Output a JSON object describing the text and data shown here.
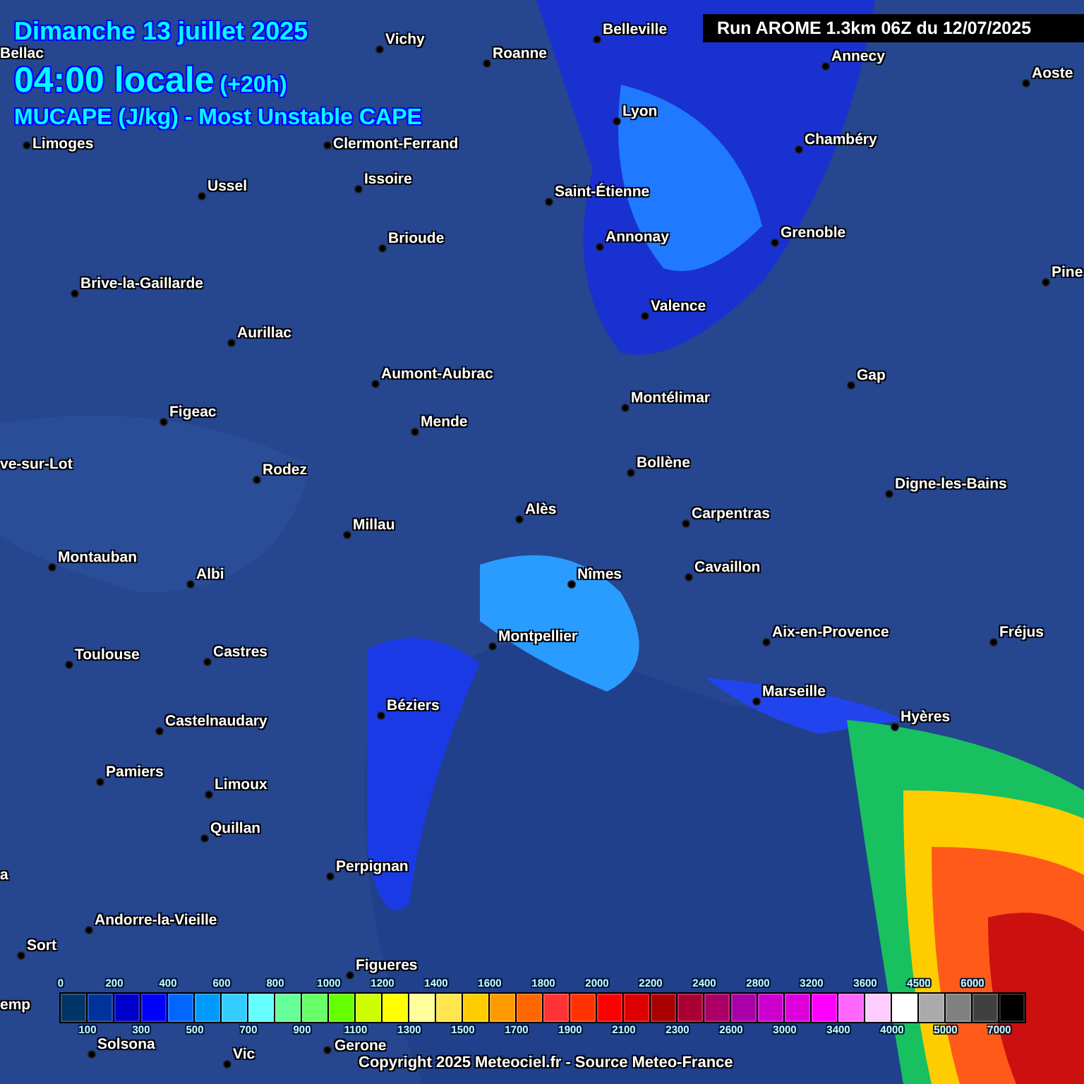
{
  "title": {
    "date": "Dimanche 13 juillet 2025",
    "time": "04:00 locale",
    "offset": "(+20h)",
    "parameter": "MUCAPE (J/kg) - Most Unstable CAPE"
  },
  "run_label": "Run AROME 1.3km 06Z du 12/07/2025",
  "cities": [
    {
      "name": "Bellac"
    },
    {
      "name": "Vichy"
    },
    {
      "name": "Roanne"
    },
    {
      "name": "Belleville"
    },
    {
      "name": "Annecy"
    },
    {
      "name": "Aoste"
    },
    {
      "name": "Lyon"
    },
    {
      "name": "Limoges"
    },
    {
      "name": "Clermont-Ferrand"
    },
    {
      "name": "Chambéry"
    },
    {
      "name": "Issoire"
    },
    {
      "name": "Ussel"
    },
    {
      "name": "Saint-Étienne"
    },
    {
      "name": "Annonay"
    },
    {
      "name": "Grenoble"
    },
    {
      "name": "Brioude"
    },
    {
      "name": "Pine"
    },
    {
      "name": "Brive-la-Gaillarde"
    },
    {
      "name": "Valence"
    },
    {
      "name": "Aurillac"
    },
    {
      "name": "Aumont-Aubrac"
    },
    {
      "name": "Gap"
    },
    {
      "name": "Montélimar"
    },
    {
      "name": "Figeac"
    },
    {
      "name": "Mende"
    },
    {
      "name": "ve-sur-Lot"
    },
    {
      "name": "Rodez"
    },
    {
      "name": "Bollène"
    },
    {
      "name": "Digne-les-Bains"
    },
    {
      "name": "Alès"
    },
    {
      "name": "Carpentras"
    },
    {
      "name": "Millau"
    },
    {
      "name": "Montauban"
    },
    {
      "name": "Cavaillon"
    },
    {
      "name": "Albi"
    },
    {
      "name": "Nîmes"
    },
    {
      "name": "Montpellier"
    },
    {
      "name": "Aix-en-Provence"
    },
    {
      "name": "Fréjus"
    },
    {
      "name": "Toulouse"
    },
    {
      "name": "Castres"
    },
    {
      "name": "Marseille"
    },
    {
      "name": "Béziers"
    },
    {
      "name": "Hyères"
    },
    {
      "name": "Castelnaudary"
    },
    {
      "name": "Pamiers"
    },
    {
      "name": "Limoux"
    },
    {
      "name": "Quillan"
    },
    {
      "name": "Perpignan"
    },
    {
      "name": "a"
    },
    {
      "name": "Andorre-la-Vieille"
    },
    {
      "name": "Sort"
    },
    {
      "name": "Figueres"
    },
    {
      "name": "emp"
    },
    {
      "name": "Gerone"
    },
    {
      "name": "Solsona"
    },
    {
      "name": "Vic"
    }
  ],
  "legend": [
    {
      "tick": "0",
      "color": "#003366"
    },
    {
      "tick": "100",
      "color": "#003399"
    },
    {
      "tick": "200",
      "color": "#0000cc"
    },
    {
      "tick": "300",
      "color": "#0000ff"
    },
    {
      "tick": "400",
      "color": "#0066ff"
    },
    {
      "tick": "500",
      "color": "#0099ff"
    },
    {
      "tick": "600",
      "color": "#33ccff"
    },
    {
      "tick": "700",
      "color": "#66ffff"
    },
    {
      "tick": "800",
      "color": "#66ff99"
    },
    {
      "tick": "900",
      "color": "#66ff66"
    },
    {
      "tick": "1000",
      "color": "#66ff00"
    },
    {
      "tick": "1100",
      "color": "#ccff00"
    },
    {
      "tick": "1200",
      "color": "#ffff00"
    },
    {
      "tick": "1300",
      "color": "#ffff99"
    },
    {
      "tick": "1400",
      "color": "#ffe64d"
    },
    {
      "tick": "1500",
      "color": "#ffcc00"
    },
    {
      "tick": "1600",
      "color": "#ff9900"
    },
    {
      "tick": "1700",
      "color": "#ff6600"
    },
    {
      "tick": "1800",
      "color": "#ff3333"
    },
    {
      "tick": "1900",
      "color": "#ff3300"
    },
    {
      "tick": "2000",
      "color": "#ff0000"
    },
    {
      "tick": "2100",
      "color": "#dd0000"
    },
    {
      "tick": "2200",
      "color": "#aa0000"
    },
    {
      "tick": "2300",
      "color": "#aa0033"
    },
    {
      "tick": "2400",
      "color": "#aa0066"
    },
    {
      "tick": "2600",
      "color": "#aa00aa"
    },
    {
      "tick": "2800",
      "color": "#cc00cc"
    },
    {
      "tick": "3000",
      "color": "#dd00dd"
    },
    {
      "tick": "3200",
      "color": "#ff00ff"
    },
    {
      "tick": "3400",
      "color": "#ff66ff"
    },
    {
      "tick": "3600",
      "color": "#ffccff"
    },
    {
      "tick": "4000",
      "color": "#ffffff"
    },
    {
      "tick": "4500",
      "color": "#aaaaaa"
    },
    {
      "tick": "5000",
      "color": "#808080"
    },
    {
      "tick": "6000",
      "color": "#404040"
    },
    {
      "tick": "7000",
      "color": "#000000"
    }
  ],
  "copyright": "Copyright 2025 Meteociel.fr - Source Meteo-France"
}
